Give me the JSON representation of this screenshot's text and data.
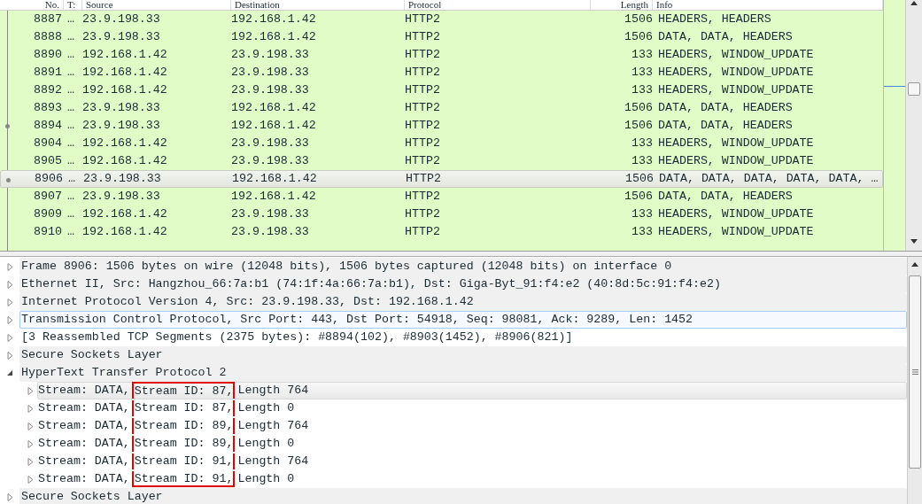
{
  "packet_list": {
    "columns": [
      {
        "label": "No."
      },
      {
        "label": "T:"
      },
      {
        "label": "Source"
      },
      {
        "label": "Destination"
      },
      {
        "label": "Protocol"
      },
      {
        "label": "Length"
      },
      {
        "label": "Info"
      }
    ],
    "rows": [
      {
        "cells": [
          "8887",
          "…",
          "23.9.198.33",
          "192.168.1.42",
          "HTTP2",
          "1506",
          "HEADERS, HEADERS"
        ],
        "selected": false,
        "related": false
      },
      {
        "cells": [
          "8888",
          "…",
          "23.9.198.33",
          "192.168.1.42",
          "HTTP2",
          "1506",
          "DATA, DATA, HEADERS"
        ],
        "selected": false,
        "related": false
      },
      {
        "cells": [
          "8890",
          "…",
          "192.168.1.42",
          "23.9.198.33",
          "HTTP2",
          "133",
          "HEADERS, WINDOW_UPDATE"
        ],
        "selected": false,
        "related": false
      },
      {
        "cells": [
          "8891",
          "…",
          "192.168.1.42",
          "23.9.198.33",
          "HTTP2",
          "133",
          "HEADERS, WINDOW_UPDATE"
        ],
        "selected": false,
        "related": false
      },
      {
        "cells": [
          "8892",
          "…",
          "192.168.1.42",
          "23.9.198.33",
          "HTTP2",
          "133",
          "HEADERS, WINDOW_UPDATE"
        ],
        "selected": false,
        "related": false
      },
      {
        "cells": [
          "8893",
          "…",
          "23.9.198.33",
          "192.168.1.42",
          "HTTP2",
          "1506",
          "DATA, DATA, HEADERS"
        ],
        "selected": false,
        "related": false
      },
      {
        "cells": [
          "8894",
          "…",
          "23.9.198.33",
          "192.168.1.42",
          "HTTP2",
          "1506",
          "DATA, DATA, HEADERS"
        ],
        "selected": false,
        "related": true
      },
      {
        "cells": [
          "8904",
          "…",
          "192.168.1.42",
          "23.9.198.33",
          "HTTP2",
          "133",
          "HEADERS, WINDOW_UPDATE"
        ],
        "selected": false,
        "related": false
      },
      {
        "cells": [
          "8905",
          "…",
          "192.168.1.42",
          "23.9.198.33",
          "HTTP2",
          "133",
          "HEADERS, WINDOW_UPDATE"
        ],
        "selected": false,
        "related": false
      },
      {
        "cells": [
          "8906",
          "…",
          "23.9.198.33",
          "192.168.1.42",
          "HTTP2",
          "1506",
          "DATA, DATA, DATA, DATA, DATA, …"
        ],
        "selected": true,
        "related": true
      },
      {
        "cells": [
          "8907",
          "…",
          "23.9.198.33",
          "192.168.1.42",
          "HTTP2",
          "1506",
          "DATA, DATA, HEADERS"
        ],
        "selected": false,
        "related": false
      },
      {
        "cells": [
          "8909",
          "…",
          "192.168.1.42",
          "23.9.198.33",
          "HTTP2",
          "133",
          "HEADERS, WINDOW_UPDATE"
        ],
        "selected": false,
        "related": false
      },
      {
        "cells": [
          "8910",
          "…",
          "192.168.1.42",
          "23.9.198.33",
          "HTTP2",
          "133",
          "HEADERS, WINDOW_UPDATE"
        ],
        "selected": false,
        "related": false
      }
    ]
  },
  "details": [
    {
      "text": "Frame 8906: 1506 bytes on wire (12048 bits), 1506 bytes captured (12048 bits) on interface 0",
      "expanded": false,
      "selected": false,
      "kind": "protocol"
    },
    {
      "text": "Ethernet II, Src: Hangzhou_66:7a:b1 (74:1f:4a:66:7a:b1), Dst: Giga-Byt_91:f4:e2 (40:8d:5c:91:f4:e2)",
      "expanded": false,
      "selected": false,
      "kind": "protocol"
    },
    {
      "text": "Internet Protocol Version 4, Src: 23.9.198.33, Dst: 192.168.1.42",
      "expanded": false,
      "selected": false,
      "kind": "protocol"
    },
    {
      "text": "Transmission Control Protocol, Src Port: 443, Dst Port: 54918, Seq: 98081, Ack: 9289, Len: 1452",
      "expanded": false,
      "selected": true,
      "kind": "protocol"
    },
    {
      "text": "[3 Reassembled TCP Segments (2375 bytes): #8894(102), #8903(1452), #8906(821)]",
      "expanded": false,
      "selected": false,
      "kind": "generated"
    },
    {
      "text": "Secure Sockets Layer",
      "expanded": false,
      "selected": false,
      "kind": "protocol"
    },
    {
      "text": "HyperText Transfer Protocol 2",
      "expanded": true,
      "selected": false,
      "kind": "protocol",
      "children": [
        {
          "type": "Stream: DATA,",
          "stream_id": "Stream ID: 87,",
          "length": "Length 764",
          "hovered": true
        },
        {
          "type": "Stream: DATA,",
          "stream_id": "Stream ID: 87,",
          "length": "Length 0",
          "hovered": false
        },
        {
          "type": "Stream: DATA,",
          "stream_id": "Stream ID: 89,",
          "length": "Length 764",
          "hovered": false
        },
        {
          "type": "Stream: DATA,",
          "stream_id": "Stream ID: 89,",
          "length": "Length 0",
          "hovered": false
        },
        {
          "type": "Stream: DATA,",
          "stream_id": "Stream ID: 91,",
          "length": "Length 764",
          "hovered": false
        },
        {
          "type": "Stream: DATA,",
          "stream_id": "Stream ID: 91,",
          "length": "Length 0",
          "hovered": false
        }
      ]
    },
    {
      "text": "Secure Sockets Layer",
      "expanded": false,
      "selected": false,
      "kind": "protocol"
    }
  ]
}
